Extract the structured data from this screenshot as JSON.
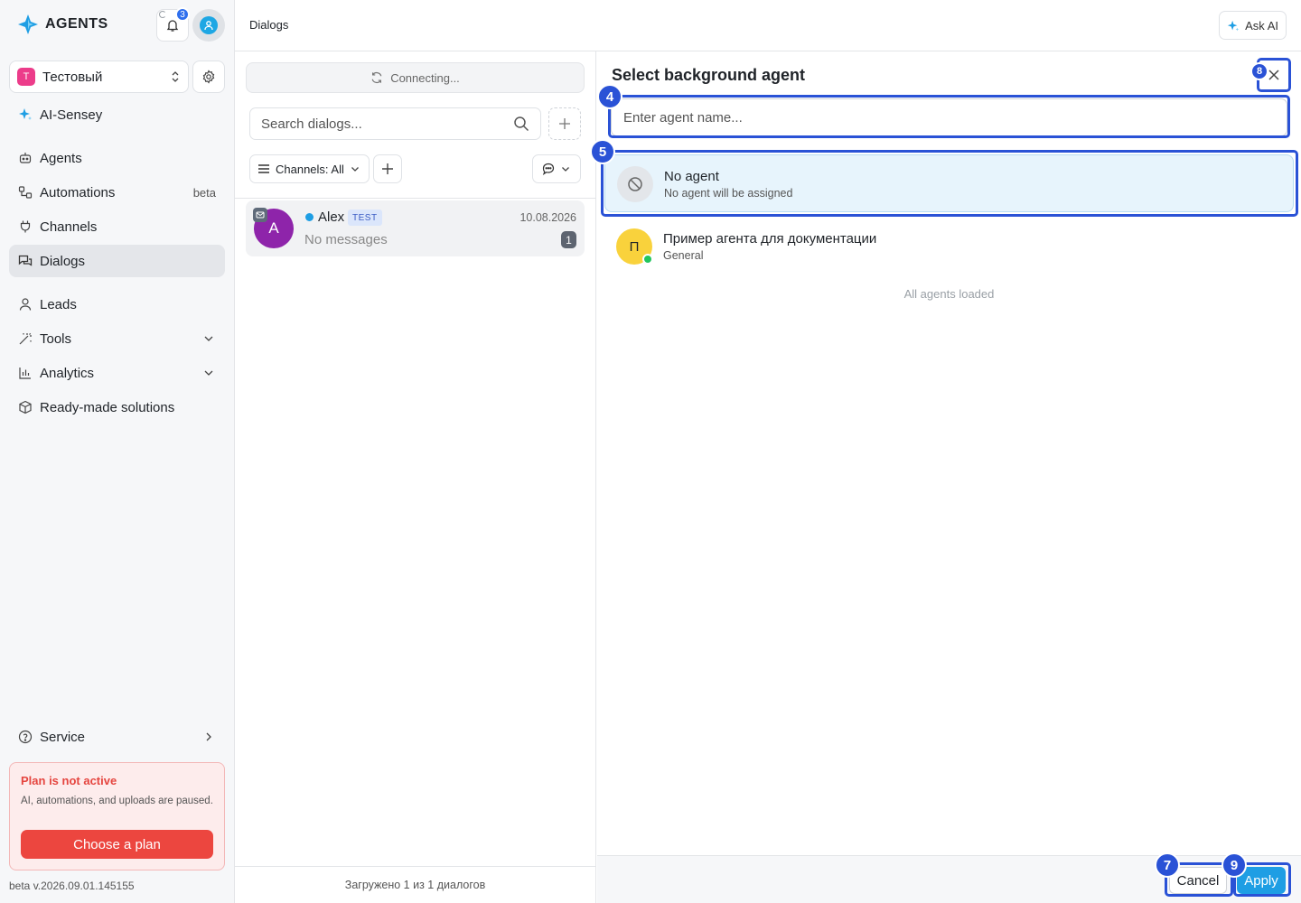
{
  "sidebar": {
    "logo_text": "AGENTS",
    "notifications_count": "3",
    "workspace": {
      "avatar_letter": "Т",
      "name": "Тестовый"
    },
    "items": [
      {
        "label": "AI-Sensey"
      },
      {
        "label": "Agents"
      },
      {
        "label": "Automations",
        "badge": "beta"
      },
      {
        "label": "Channels"
      },
      {
        "label": "Dialogs"
      },
      {
        "label": "Leads"
      },
      {
        "label": "Tools"
      },
      {
        "label": "Analytics"
      },
      {
        "label": "Ready-made solutions"
      }
    ],
    "service_label": "Service",
    "plan": {
      "title": "Plan is not active",
      "description": "AI, automations, and uploads are paused.",
      "button": "Choose a plan"
    },
    "version": "beta v.2026.09.01.145155"
  },
  "topbar": {
    "title": "Dialogs",
    "ask_ai": "Ask AI"
  },
  "dialogs": {
    "connecting": "Connecting...",
    "search_placeholder": "Search dialogs...",
    "channels_filter": "Channels: All",
    "list": [
      {
        "avatar": "A",
        "name": "Alex",
        "tag": "TEST",
        "date": "10.08.2026",
        "last_message": "No messages",
        "unread": "1"
      }
    ],
    "footer": "Загружено 1 из 1 диалогов"
  },
  "panel": {
    "title": "Select background agent",
    "search_placeholder": "Enter agent name...",
    "options": [
      {
        "title": "No agent",
        "subtitle": "No agent will be assigned"
      },
      {
        "avatar": "П",
        "title": "Пример агента для документации",
        "subtitle": "General"
      }
    ],
    "all_loaded": "All agents loaded",
    "cancel": "Cancel",
    "apply": "Apply"
  },
  "annotations": {
    "input": "4",
    "no_agent": "5",
    "cancel": "7",
    "close": "8",
    "apply": "9"
  },
  "colors": {
    "accent": "#1e9ee4",
    "annotation": "#2a52d6",
    "danger": "#ec463f"
  }
}
